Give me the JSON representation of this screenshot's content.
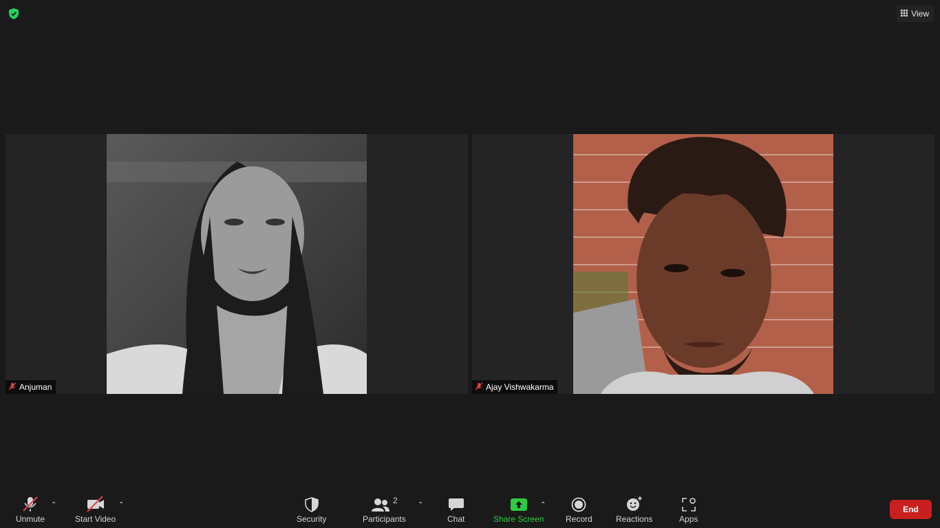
{
  "top": {
    "view_label": "View"
  },
  "participants": [
    {
      "name": "Anjuman",
      "muted": true
    },
    {
      "name": "Ajay Vishwakarma",
      "muted": true
    }
  ],
  "toolbar": {
    "unmute": "Unmute",
    "start_video": "Start Video",
    "security": "Security",
    "participants": "Participants",
    "participant_count": "2",
    "chat": "Chat",
    "share_screen": "Share Screen",
    "record": "Record",
    "reactions": "Reactions",
    "apps": "Apps",
    "end": "End"
  },
  "colors": {
    "background": "#1a1a1a",
    "tile": "#242424",
    "accent_green": "#2ecc40",
    "end_red": "#c8201f",
    "muted_red": "#e04343"
  }
}
